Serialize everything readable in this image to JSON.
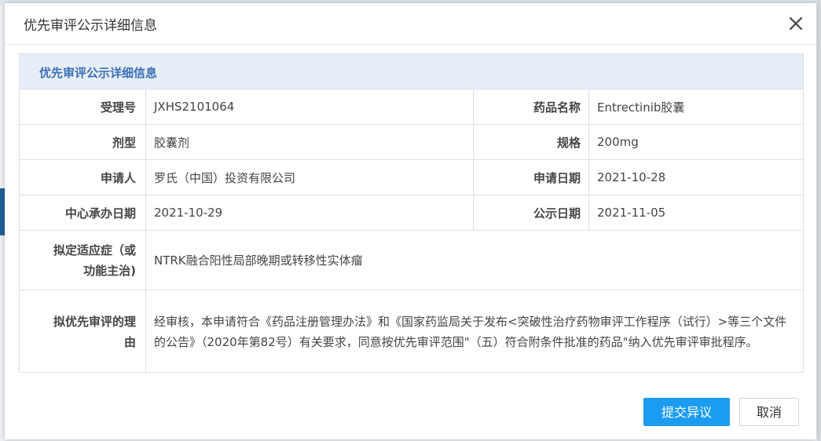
{
  "dialog": {
    "title": "优先审评公示详细信息",
    "close_icon": "close-icon"
  },
  "panel": {
    "heading": "优先审评公示详细信息",
    "fields": {
      "acceptance_no_label": "受理号",
      "acceptance_no": "JXHS2101064",
      "drug_name_label": "药品名称",
      "drug_name": "Entrectinib胶囊",
      "dosage_form_label": "剂型",
      "dosage_form": "胶囊剂",
      "spec_label": "规格",
      "spec": "200mg",
      "applicant_label": "申请人",
      "applicant": "罗氏（中国）投资有限公司",
      "apply_date_label": "申请日期",
      "apply_date": "2021-10-28",
      "center_date_label": "中心承办日期",
      "center_date": "2021-10-29",
      "publish_date_label": "公示日期",
      "publish_date": "2021-11-05",
      "indication_label_line1": "拟定适应症（或",
      "indication_label_line2": "功能主治)",
      "indication": "NTRK融合阳性局部晚期或转移性实体瘤",
      "reason_label_line1": "拟优先审评的理",
      "reason_label_line2": "由",
      "reason": "经审核，本申请符合《药品注册管理办法》和《国家药监局关于发布<突破性治疗药物审评工作程序（试行）>等三个文件的公告》（2020年第82号）有关要求，同意按优先审评范围\"（五）符合附条件批准的药品\"纳入优先审评审批程序。"
    }
  },
  "buttons": {
    "submit_objection": "提交异议",
    "cancel": "取消"
  },
  "colors": {
    "primary": "#1c9cf0",
    "panel_head_bg": "#e8eef8",
    "panel_head_text": "#3a6fb5"
  }
}
